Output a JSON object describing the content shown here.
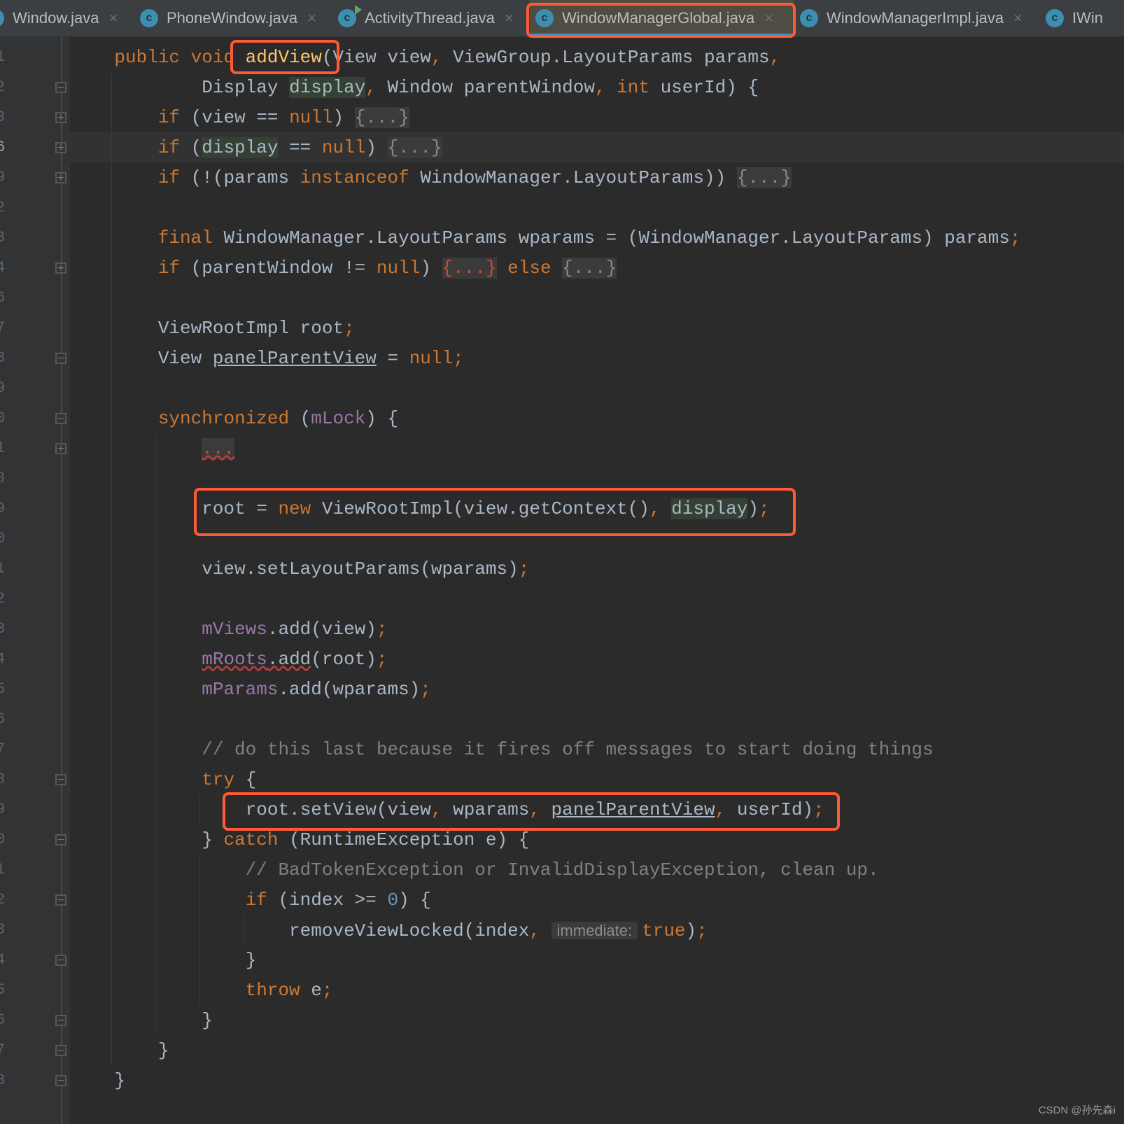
{
  "tabs": [
    {
      "label": "Window.java",
      "icon": "partial-class-icon",
      "active": false
    },
    {
      "label": "PhoneWindow.java",
      "icon": "class-icon",
      "active": false
    },
    {
      "label": "ActivityThread.java",
      "icon": "runnable-class-icon",
      "active": false
    },
    {
      "label": "WindowManagerGlobal.java",
      "icon": "class-icon",
      "active": true
    },
    {
      "label": "WindowManagerImpl.java",
      "icon": "class-icon",
      "active": false
    },
    {
      "label": "IWin",
      "icon": "class-icon",
      "active": false
    }
  ],
  "line_numbers": [
    "1",
    "2",
    "3",
    "6",
    "9",
    "2",
    "3",
    "4",
    "6",
    "7",
    "8",
    "9",
    "0",
    "1",
    "8",
    "9",
    "0",
    "1",
    "2",
    "3",
    "4",
    "5",
    "6",
    "7",
    "8",
    "9",
    "0",
    "1",
    "2",
    "3",
    "4",
    "5",
    "6",
    "7",
    "8"
  ],
  "code": [
    [
      [
        "pl",
        "    "
      ],
      [
        "kw",
        "public void "
      ],
      [
        "md",
        "addView"
      ],
      [
        "pl",
        "(View view"
      ],
      [
        "kw",
        ", "
      ],
      [
        "pl",
        "ViewGroup.LayoutParams params"
      ],
      [
        "kw",
        ","
      ]
    ],
    [
      [
        "pl",
        "            Display "
      ],
      [
        "hl",
        "display"
      ],
      [
        "kw",
        ", "
      ],
      [
        "pl",
        "Window parentWindow"
      ],
      [
        "kw",
        ", int "
      ],
      [
        "pl",
        "userId) {"
      ]
    ],
    [
      [
        "pl",
        "        "
      ],
      [
        "kw",
        "if "
      ],
      [
        "pl",
        "(view == "
      ],
      [
        "kw",
        "null"
      ],
      [
        "pl",
        ") "
      ],
      [
        "fo",
        "{...}"
      ]
    ],
    [
      [
        "pl",
        "        "
      ],
      [
        "kw",
        "if "
      ],
      [
        "pl",
        "("
      ],
      [
        "hl",
        "display"
      ],
      [
        "pl",
        " == "
      ],
      [
        "kw",
        "null"
      ],
      [
        "pl",
        ") "
      ],
      [
        "fo",
        "{...}"
      ]
    ],
    [
      [
        "pl",
        "        "
      ],
      [
        "kw",
        "if "
      ],
      [
        "pl",
        "(!(params "
      ],
      [
        "kw",
        "instanceof "
      ],
      [
        "pl",
        "WindowManager.LayoutParams)) "
      ],
      [
        "fo",
        "{...}"
      ]
    ],
    [],
    [
      [
        "pl",
        "        "
      ],
      [
        "kw",
        "final "
      ],
      [
        "pl",
        "WindowManager.LayoutParams wparams = (WindowManager.LayoutParams) params"
      ],
      [
        "kw",
        ";"
      ]
    ],
    [
      [
        "pl",
        "        "
      ],
      [
        "kw",
        "if "
      ],
      [
        "pl",
        "(parentWindow != "
      ],
      [
        "kw",
        "null"
      ],
      [
        "pl",
        ") "
      ],
      [
        "fr",
        "{...}"
      ],
      [
        "kw",
        " else "
      ],
      [
        "fo",
        "{...}"
      ]
    ],
    [],
    [
      [
        "pl",
        "        ViewRootImpl root"
      ],
      [
        "kw",
        ";"
      ]
    ],
    [
      [
        "pl",
        "        View "
      ],
      [
        "ul",
        "panelParentView"
      ],
      [
        "pl",
        " = "
      ],
      [
        "kw",
        "null;"
      ]
    ],
    [],
    [
      [
        "pl",
        "        "
      ],
      [
        "kw",
        "synchronized "
      ],
      [
        "pl",
        "("
      ],
      [
        "fd",
        "mLock"
      ],
      [
        "pl",
        ") {"
      ]
    ],
    [
      [
        "pl",
        "            "
      ],
      [
        "fr wv",
        "..."
      ]
    ],
    [],
    [
      [
        "pl",
        "            root = "
      ],
      [
        "kw",
        "new "
      ],
      [
        "pl",
        "ViewRootImpl(view.getContext()"
      ],
      [
        "kw",
        ", "
      ],
      [
        "hl",
        "display"
      ],
      [
        "pl",
        ")"
      ],
      [
        "kw",
        ";"
      ]
    ],
    [],
    [
      [
        "pl",
        "            view.setLayoutParams(wparams)"
      ],
      [
        "kw",
        ";"
      ]
    ],
    [],
    [
      [
        "pl",
        "            "
      ],
      [
        "fd",
        "mViews"
      ],
      [
        "pl",
        ".add(view)"
      ],
      [
        "kw",
        ";"
      ]
    ],
    [
      [
        "pl",
        "            "
      ],
      [
        "fd wv",
        "mRoots"
      ],
      [
        "pl wv",
        ".add"
      ],
      [
        "pl",
        "(root)"
      ],
      [
        "kw",
        ";"
      ]
    ],
    [
      [
        "pl",
        "            "
      ],
      [
        "fd",
        "mParams"
      ],
      [
        "pl",
        ".add(wparams)"
      ],
      [
        "kw",
        ";"
      ]
    ],
    [],
    [
      [
        "pl",
        "            "
      ],
      [
        "cm",
        "// do this last because it fires off messages to start doing things"
      ]
    ],
    [
      [
        "pl",
        "            "
      ],
      [
        "kw",
        "try "
      ],
      [
        "pl",
        "{"
      ]
    ],
    [
      [
        "pl",
        "                root.setView(view"
      ],
      [
        "kw",
        ", "
      ],
      [
        "pl",
        "wparams"
      ],
      [
        "kw",
        ", "
      ],
      [
        "ul",
        "panelParentView"
      ],
      [
        "kw",
        ", "
      ],
      [
        "pl",
        "userId)"
      ],
      [
        "kw",
        ";"
      ]
    ],
    [
      [
        "pl",
        "            } "
      ],
      [
        "kw",
        "catch "
      ],
      [
        "pl",
        "(RuntimeException e) {"
      ]
    ],
    [
      [
        "pl",
        "                "
      ],
      [
        "cm",
        "// BadTokenException or InvalidDisplayException, clean up."
      ]
    ],
    [
      [
        "pl",
        "                "
      ],
      [
        "kw",
        "if "
      ],
      [
        "pl",
        "(index >= "
      ],
      [
        "nm",
        "0"
      ],
      [
        "pl",
        ") {"
      ]
    ],
    [
      [
        "pl",
        "                    removeViewLocked(index"
      ],
      [
        "kw",
        ", "
      ],
      [
        "hint",
        "immediate:"
      ],
      [
        "kw",
        "true"
      ],
      [
        "pl",
        ")"
      ],
      [
        "kw",
        ";"
      ]
    ],
    [
      [
        "pl",
        "                }"
      ]
    ],
    [
      [
        "pl",
        "                "
      ],
      [
        "kw",
        "throw "
      ],
      [
        "pl",
        "e"
      ],
      [
        "kw",
        ";"
      ]
    ],
    [
      [
        "pl",
        "            }"
      ]
    ],
    [
      [
        "pl",
        "        }"
      ]
    ],
    [
      [
        "pl",
        "    }"
      ]
    ]
  ],
  "folds": {
    "1": "minus",
    "2": "plus",
    "3": "plus",
    "4": "plus",
    "7": "plus",
    "10": "end",
    "12": "minus",
    "13": "plus",
    "24": "minus",
    "26": "end",
    "28": "minus",
    "30": "end",
    "32": "end",
    "33": "end",
    "34": "end"
  },
  "watermark": "CSDN @孙先森i",
  "colors": {
    "highlight_box": "#ff5a36",
    "keyword": "#cc7832",
    "field": "#9876aa",
    "background": "#2b2b2b"
  }
}
